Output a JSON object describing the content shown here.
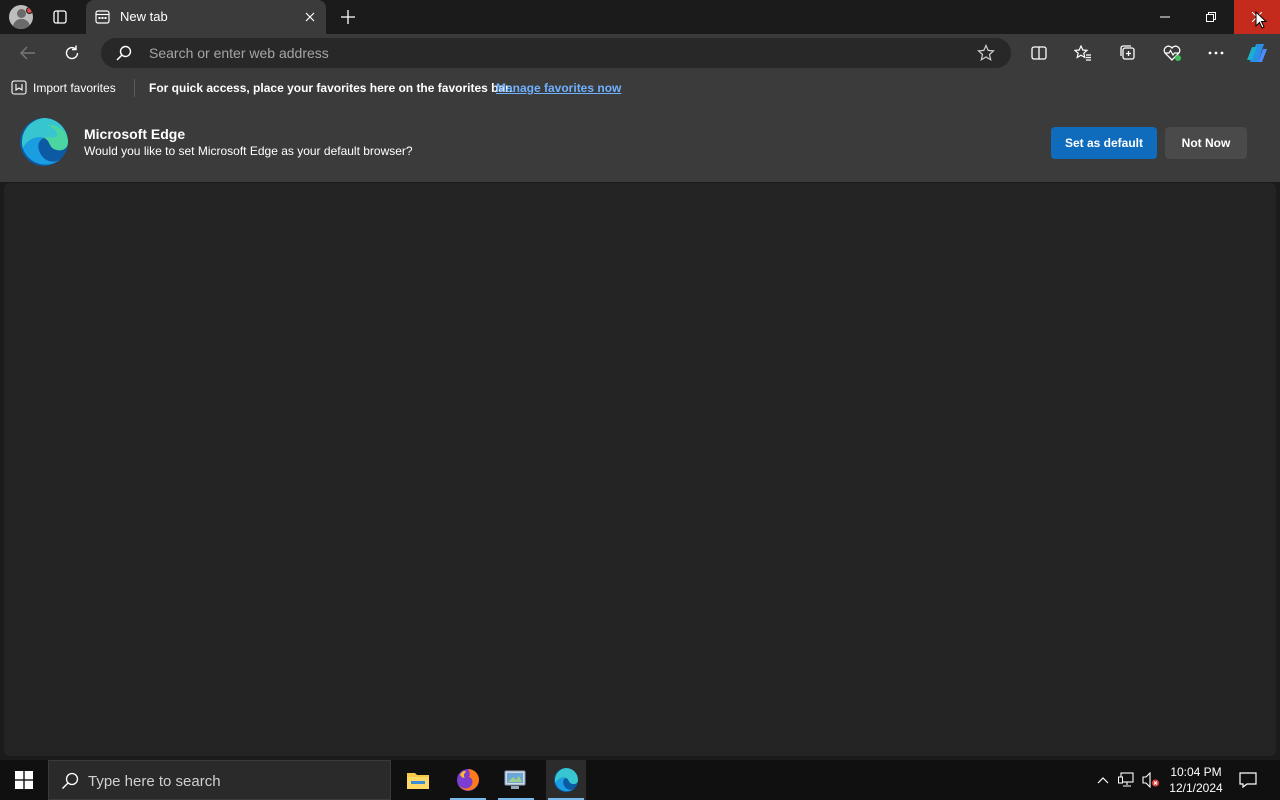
{
  "tab": {
    "title": "New tab"
  },
  "address_bar": {
    "placeholder": "Search or enter web address"
  },
  "favorites_bar": {
    "import_label": "Import favorites",
    "message": "For quick access, place your favorites here on the favorites bar.",
    "link": "Manage favorites now"
  },
  "banner": {
    "title": "Microsoft Edge",
    "subtitle": "Would you like to set Microsoft Edge as your default browser?",
    "primary_button": "Set as default",
    "secondary_button": "Not Now"
  },
  "taskbar": {
    "search_placeholder": "Type here to search",
    "time": "10:04 PM",
    "date": "12/1/2024",
    "apps": [
      "file-explorer",
      "firefox",
      "control-panel",
      "microsoft-edge"
    ]
  },
  "colors": {
    "accent": "#0f6cbd",
    "link": "#6fb1ff",
    "close_hover": "#c42b1c",
    "toolbar": "#3b3b3b",
    "content": "#242424"
  }
}
